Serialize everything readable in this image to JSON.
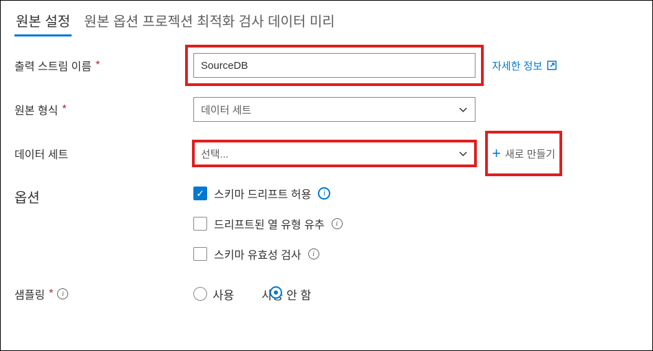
{
  "tabs": {
    "active": "원본 설정",
    "rest": "원본 옵션 프로젝션 최적화 검사 데이터 미리"
  },
  "fields": {
    "outputStream": {
      "label": "출력 스트림 이름",
      "value": "SourceDB"
    },
    "sourceType": {
      "label": "원본 형식",
      "selected": "데이터 세트"
    },
    "dataset": {
      "label": "데이터 세트",
      "placeholder": "선택..."
    }
  },
  "links": {
    "learnMore": "자세한 정보",
    "new": "새로 만들기"
  },
  "options": {
    "sectionLabel": "옵션",
    "schemaDrift": "스키마 드리프트 허용",
    "inferDrifted": "드리프트된 열 유형 유추",
    "validateSchema": "스키마 유효성 검사"
  },
  "sampling": {
    "label": "샘플링",
    "use": "사용",
    "notUse": "사용 안 함"
  }
}
